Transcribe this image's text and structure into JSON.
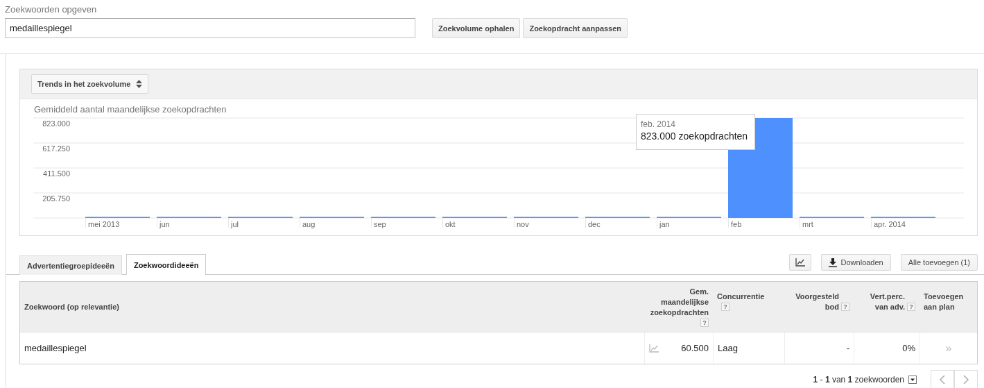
{
  "keywords_field": {
    "label": "Zoekwoorden opgeven",
    "value": "medaillespiegel"
  },
  "top_buttons": [
    "Zoekvolume ophalen",
    "Zoekopdracht aanpassen"
  ],
  "chart_panel": {
    "selector": "Trends in het zoekvolume",
    "chart_data": {
      "type": "bar",
      "title": "Gemiddeld aantal maandelijkse zoekopdrachten",
      "categories": [
        "mei 2013",
        "jun",
        "jul",
        "aug",
        "sep",
        "okt",
        "nov",
        "dec",
        "jan",
        "feb",
        "mrt",
        "apr. 2014"
      ],
      "series": [
        {
          "color": "#4d90fe",
          "values": [
            2000,
            2000,
            2000,
            2000,
            2000,
            2000,
            2000,
            2000,
            2000,
            823000,
            4000,
            2000
          ]
        }
      ],
      "grid": true,
      "ylim": [
        0,
        823000
      ],
      "yticks": [
        {
          "value": 205750,
          "label": "205.750"
        },
        {
          "value": 411500,
          "label": "411.500"
        },
        {
          "value": 617250,
          "label": "617.250"
        },
        {
          "value": 823000,
          "label": "823.000"
        }
      ]
    },
    "tooltip": {
      "title": "feb. 2014",
      "value": "823.000 zoekopdrachten"
    }
  },
  "tabs": [
    {
      "label": "Advertentiegroepideeën",
      "selected": false
    },
    {
      "label": "Zoekwoordideeën",
      "selected": true
    }
  ],
  "toolbar": {
    "download": "Downloaden",
    "add_all": "Alle toevoegen (1)"
  },
  "table": {
    "columns": [
      {
        "label": "Zoekwoord (op relevantie)"
      },
      {
        "label": "Gem. maandelijkse zoekopdrachten",
        "help": "?"
      },
      {
        "label": "Concurrentie",
        "help": "?"
      },
      {
        "label": "Voorgesteld bod",
        "help": "?"
      },
      {
        "label": "Vert.perc. van adv.",
        "help": "?"
      },
      {
        "label": "Toevoegen aan plan"
      }
    ],
    "rows": [
      {
        "keyword": "medaillespiegel",
        "volume": "60.500",
        "competition": "Laag",
        "bid": "-",
        "share": "0%",
        "add": "»"
      }
    ]
  },
  "pagination": {
    "summary": "**1** - **1** van **1** zoekwoorden"
  }
}
